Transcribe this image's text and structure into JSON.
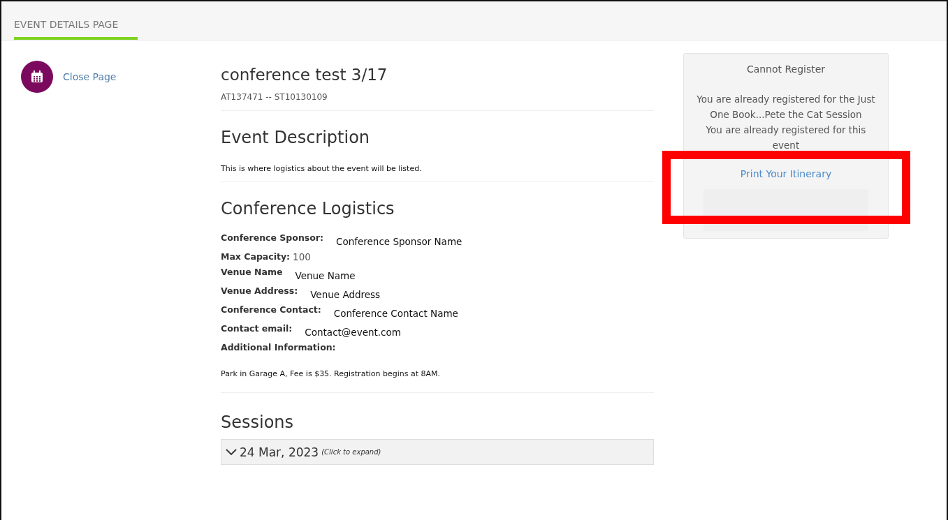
{
  "tabs": [
    {
      "label": "EVENT DETAILS PAGE",
      "selected": true
    }
  ],
  "close_link": "Close Page",
  "event": {
    "title": "conference test 3/17",
    "code": "AT137471 -- ST10130109"
  },
  "description": {
    "heading": "Event Description",
    "text": "This is where logistics about the event will be listed."
  },
  "logistics": {
    "heading": "Conference Logistics",
    "fields": [
      {
        "label": "Conference Sponsor:",
        "value": "Conference Sponsor Name",
        "kind": "spaced"
      },
      {
        "label": "Max Capacity:",
        "value": "100",
        "kind": "inline"
      },
      {
        "label": "Venue Name",
        "value": "Venue Name",
        "kind": "spaced"
      },
      {
        "label": "Venue Address:",
        "value": "Venue Address",
        "kind": "spaced"
      },
      {
        "label": "Conference Contact:",
        "value": "Conference Contact Name",
        "kind": "spaced"
      },
      {
        "label": "Contact email:",
        "value": "Contact@event.com",
        "kind": "spaced"
      },
      {
        "label": "Additional Information:"
      }
    ],
    "additional_text": "Park in Garage A, Fee is $35. Registration begins at 8AM."
  },
  "sessions": {
    "heading": "Sessions",
    "groups": [
      {
        "date": "24 Mar, 2023",
        "hint": "(Click to expand)",
        "expanded": false
      }
    ]
  },
  "register_panel": {
    "title": "Cannot Register",
    "messages": [
      "You are already registered for the Just One Book...Pete the Cat Session",
      "You are already registered for this event"
    ],
    "link": "Print Your Itinerary",
    "highlighted": true
  }
}
